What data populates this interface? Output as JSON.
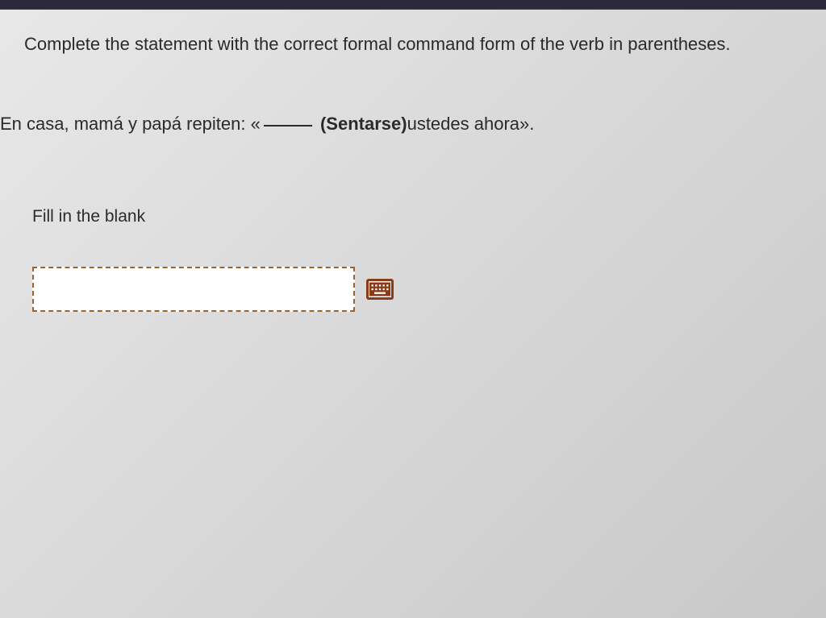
{
  "instruction": "Complete the statement with the correct formal command form of the verb in parentheses.",
  "question": {
    "prefix": "En casa, mamá y papá repiten: «",
    "verb": "(Sentarse)",
    "suffix": " ustedes ahora»."
  },
  "fill_label": "Fill in the blank",
  "input": {
    "value": "",
    "placeholder": ""
  },
  "keyboard_icon": "keyboard-icon"
}
